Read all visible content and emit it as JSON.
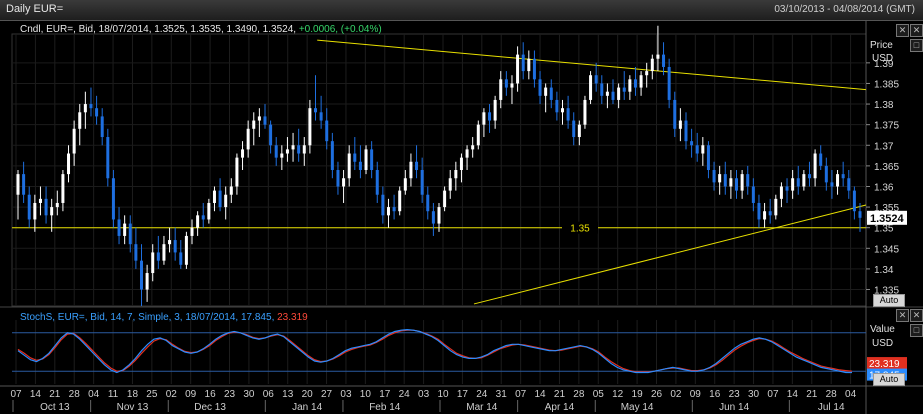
{
  "window": {
    "title": "Daily EUR=",
    "date_range": "03/10/2013 - 04/08/2014 (GMT)"
  },
  "price_panel": {
    "legend": {
      "prefix": "Cndl, EUR=, Bid, 18/07/2014, 1.3525, 1.3535, 1.3490, 1.3524,",
      "change": "+0.0006, (+0.04%)"
    },
    "axis_title_1": "Price",
    "axis_title_2": "USD",
    "last_price": "1.3524",
    "auto_label": "Auto",
    "ticks": [
      "1.39",
      "1.385",
      "1.38",
      "1.375",
      "1.37",
      "1.365",
      "1.36",
      "1.355",
      "1.35",
      "1.345",
      "1.34",
      "1.335"
    ],
    "hline_label": "1.35"
  },
  "stoch_panel": {
    "legend": {
      "prefix": "StochS, EUR=, Bid, 14, 7, Simple, 3, 18/07/2014,",
      "k": "17.845",
      "d": "23.319"
    },
    "axis_title_1": "Value",
    "axis_title_2": "USD",
    "d_badge": "23.319",
    "k_badge": "17.845",
    "auto_label": "Auto"
  },
  "x_axis": {
    "days": [
      "07",
      "14",
      "21",
      "28",
      "04",
      "11",
      "18",
      "25",
      "02",
      "09",
      "16",
      "23",
      "30",
      "06",
      "13",
      "20",
      "27",
      "03",
      "10",
      "17",
      "24",
      "03",
      "10",
      "17",
      "24",
      "31",
      "07",
      "14",
      "21",
      "28",
      "05",
      "12",
      "19",
      "26",
      "02",
      "09",
      "16",
      "23",
      "30",
      "07",
      "14",
      "21",
      "28",
      "04"
    ],
    "months": [
      "Oct 13",
      "Nov 13",
      "Dec 13",
      "Jan 14",
      "Feb 14",
      "Mar 14",
      "Apr 14",
      "May 14",
      "Jun 14",
      "Jul 14"
    ]
  },
  "colors": {
    "up": "#ffffff",
    "down": "#1e6fe0",
    "trendline": "#e8e000",
    "stoch_d": "#e03020",
    "stoch_k": "#2a8cff"
  },
  "chart_data": {
    "type": "candlestick",
    "title": "Daily EUR=",
    "ylim": [
      1.331,
      1.397
    ],
    "horizontal_line": 1.35,
    "trendlines": [
      {
        "name": "resistance",
        "from": [
          "2014-01-20",
          1.3955
        ],
        "to": [
          "2014-08-04",
          1.3835
        ]
      },
      {
        "name": "support",
        "from": [
          "2014-03-17",
          1.3315
        ],
        "to": [
          "2014-08-04",
          1.3555
        ]
      }
    ],
    "candles": [
      [
        1.358,
        1.364,
        1.352,
        1.363
      ],
      [
        1.363,
        1.366,
        1.356,
        1.358
      ],
      [
        1.358,
        1.36,
        1.35,
        1.352
      ],
      [
        1.352,
        1.358,
        1.349,
        1.356
      ],
      [
        1.356,
        1.36,
        1.353,
        1.357
      ],
      [
        1.357,
        1.36,
        1.351,
        1.353
      ],
      [
        1.353,
        1.357,
        1.349,
        1.355
      ],
      [
        1.355,
        1.359,
        1.353,
        1.356
      ],
      [
        1.356,
        1.364,
        1.354,
        1.363
      ],
      [
        1.363,
        1.37,
        1.361,
        1.368
      ],
      [
        1.368,
        1.376,
        1.365,
        1.374
      ],
      [
        1.374,
        1.38,
        1.37,
        1.378
      ],
      [
        1.378,
        1.383,
        1.374,
        1.38
      ],
      [
        1.38,
        1.384,
        1.377,
        1.379
      ],
      [
        1.379,
        1.382,
        1.375,
        1.377
      ],
      [
        1.377,
        1.379,
        1.37,
        1.372
      ],
      [
        1.372,
        1.374,
        1.36,
        1.362
      ],
      [
        1.362,
        1.364,
        1.35,
        1.352
      ],
      [
        1.352,
        1.355,
        1.346,
        1.348
      ],
      [
        1.348,
        1.353,
        1.346,
        1.351
      ],
      [
        1.351,
        1.353,
        1.344,
        1.346
      ],
      [
        1.346,
        1.35,
        1.34,
        1.342
      ],
      [
        1.342,
        1.346,
        1.331,
        1.335
      ],
      [
        1.335,
        1.341,
        1.332,
        1.339
      ],
      [
        1.339,
        1.346,
        1.337,
        1.344
      ],
      [
        1.344,
        1.348,
        1.34,
        1.342
      ],
      [
        1.342,
        1.348,
        1.341,
        1.346
      ],
      [
        1.346,
        1.35,
        1.344,
        1.347
      ],
      [
        1.347,
        1.35,
        1.342,
        1.344
      ],
      [
        1.344,
        1.347,
        1.34,
        1.341
      ],
      [
        1.341,
        1.349,
        1.34,
        1.348
      ],
      [
        1.348,
        1.352,
        1.346,
        1.35
      ],
      [
        1.35,
        1.354,
        1.348,
        1.353
      ],
      [
        1.353,
        1.356,
        1.35,
        1.352
      ],
      [
        1.352,
        1.357,
        1.351,
        1.356
      ],
      [
        1.356,
        1.36,
        1.354,
        1.359
      ],
      [
        1.359,
        1.362,
        1.354,
        1.355
      ],
      [
        1.355,
        1.36,
        1.352,
        1.358
      ],
      [
        1.358,
        1.362,
        1.356,
        1.36
      ],
      [
        1.36,
        1.368,
        1.358,
        1.367
      ],
      [
        1.367,
        1.371,
        1.364,
        1.369
      ],
      [
        1.369,
        1.376,
        1.367,
        1.374
      ],
      [
        1.374,
        1.378,
        1.37,
        1.376
      ],
      [
        1.376,
        1.379,
        1.372,
        1.377
      ],
      [
        1.377,
        1.38,
        1.374,
        1.375
      ],
      [
        1.375,
        1.376,
        1.368,
        1.37
      ],
      [
        1.37,
        1.372,
        1.365,
        1.367
      ],
      [
        1.367,
        1.37,
        1.364,
        1.368
      ],
      [
        1.368,
        1.372,
        1.366,
        1.369
      ],
      [
        1.369,
        1.373,
        1.366,
        1.37
      ],
      [
        1.37,
        1.374,
        1.366,
        1.368
      ],
      [
        1.368,
        1.372,
        1.365,
        1.37
      ],
      [
        1.37,
        1.381,
        1.368,
        1.379
      ],
      [
        1.379,
        1.387,
        1.376,
        1.378
      ],
      [
        1.378,
        1.382,
        1.374,
        1.376
      ],
      [
        1.376,
        1.379,
        1.369,
        1.371
      ],
      [
        1.371,
        1.373,
        1.362,
        1.364
      ],
      [
        1.364,
        1.366,
        1.358,
        1.36
      ],
      [
        1.36,
        1.364,
        1.356,
        1.362
      ],
      [
        1.362,
        1.37,
        1.36,
        1.368
      ],
      [
        1.368,
        1.372,
        1.364,
        1.366
      ],
      [
        1.366,
        1.37,
        1.362,
        1.364
      ],
      [
        1.364,
        1.37,
        1.363,
        1.369
      ],
      [
        1.369,
        1.371,
        1.362,
        1.364
      ],
      [
        1.364,
        1.366,
        1.356,
        1.358
      ],
      [
        1.358,
        1.36,
        1.351,
        1.353
      ],
      [
        1.353,
        1.357,
        1.35,
        1.355
      ],
      [
        1.355,
        1.358,
        1.352,
        1.354
      ],
      [
        1.354,
        1.36,
        1.353,
        1.359
      ],
      [
        1.359,
        1.364,
        1.358,
        1.362
      ],
      [
        1.362,
        1.368,
        1.36,
        1.366
      ],
      [
        1.366,
        1.37,
        1.362,
        1.364
      ],
      [
        1.364,
        1.367,
        1.356,
        1.358
      ],
      [
        1.358,
        1.36,
        1.352,
        1.354
      ],
      [
        1.354,
        1.356,
        1.348,
        1.351
      ],
      [
        1.351,
        1.356,
        1.349,
        1.355
      ],
      [
        1.355,
        1.36,
        1.354,
        1.359
      ],
      [
        1.359,
        1.364,
        1.357,
        1.362
      ],
      [
        1.362,
        1.366,
        1.359,
        1.364
      ],
      [
        1.364,
        1.368,
        1.361,
        1.367
      ],
      [
        1.367,
        1.37,
        1.364,
        1.369
      ],
      [
        1.369,
        1.372,
        1.367,
        1.37
      ],
      [
        1.37,
        1.376,
        1.369,
        1.375
      ],
      [
        1.375,
        1.379,
        1.372,
        1.378
      ],
      [
        1.378,
        1.38,
        1.373,
        1.376
      ],
      [
        1.376,
        1.382,
        1.374,
        1.381
      ],
      [
        1.381,
        1.388,
        1.379,
        1.386
      ],
      [
        1.386,
        1.388,
        1.382,
        1.384
      ],
      [
        1.384,
        1.387,
        1.38,
        1.385
      ],
      [
        1.385,
        1.394,
        1.383,
        1.392
      ],
      [
        1.392,
        1.395,
        1.386,
        1.388
      ],
      [
        1.388,
        1.393,
        1.386,
        1.391
      ],
      [
        1.391,
        1.393,
        1.384,
        1.386
      ],
      [
        1.386,
        1.388,
        1.38,
        1.382
      ],
      [
        1.382,
        1.385,
        1.378,
        1.384
      ],
      [
        1.384,
        1.386,
        1.379,
        1.381
      ],
      [
        1.381,
        1.383,
        1.376,
        1.378
      ],
      [
        1.378,
        1.381,
        1.375,
        1.379
      ],
      [
        1.379,
        1.382,
        1.374,
        1.376
      ],
      [
        1.376,
        1.378,
        1.37,
        1.372
      ],
      [
        1.372,
        1.376,
        1.37,
        1.375
      ],
      [
        1.375,
        1.382,
        1.374,
        1.381
      ],
      [
        1.381,
        1.388,
        1.38,
        1.387
      ],
      [
        1.387,
        1.39,
        1.383,
        1.385
      ],
      [
        1.385,
        1.387,
        1.38,
        1.382
      ],
      [
        1.382,
        1.385,
        1.379,
        1.383
      ],
      [
        1.383,
        1.386,
        1.38,
        1.381
      ],
      [
        1.381,
        1.385,
        1.379,
        1.384
      ],
      [
        1.384,
        1.388,
        1.381,
        1.383
      ],
      [
        1.383,
        1.387,
        1.381,
        1.386
      ],
      [
        1.386,
        1.389,
        1.382,
        1.384
      ],
      [
        1.384,
        1.388,
        1.382,
        1.387
      ],
      [
        1.387,
        1.39,
        1.384,
        1.388
      ],
      [
        1.388,
        1.392,
        1.386,
        1.391
      ],
      [
        1.391,
        1.399,
        1.388,
        1.392
      ],
      [
        1.392,
        1.395,
        1.387,
        1.389
      ],
      [
        1.389,
        1.391,
        1.379,
        1.381
      ],
      [
        1.381,
        1.383,
        1.372,
        1.374
      ],
      [
        1.374,
        1.379,
        1.371,
        1.376
      ],
      [
        1.376,
        1.378,
        1.369,
        1.371
      ],
      [
        1.371,
        1.374,
        1.367,
        1.37
      ],
      [
        1.37,
        1.373,
        1.366,
        1.368
      ],
      [
        1.368,
        1.372,
        1.365,
        1.37
      ],
      [
        1.37,
        1.371,
        1.362,
        1.364
      ],
      [
        1.364,
        1.366,
        1.359,
        1.361
      ],
      [
        1.361,
        1.365,
        1.358,
        1.363
      ],
      [
        1.363,
        1.366,
        1.358,
        1.36
      ],
      [
        1.36,
        1.364,
        1.357,
        1.362
      ],
      [
        1.362,
        1.364,
        1.357,
        1.359
      ],
      [
        1.359,
        1.364,
        1.357,
        1.363
      ],
      [
        1.363,
        1.365,
        1.358,
        1.36
      ],
      [
        1.36,
        1.362,
        1.354,
        1.356
      ],
      [
        1.356,
        1.358,
        1.35,
        1.352
      ],
      [
        1.352,
        1.356,
        1.35,
        1.354
      ],
      [
        1.354,
        1.357,
        1.351,
        1.353
      ],
      [
        1.353,
        1.358,
        1.352,
        1.357
      ],
      [
        1.357,
        1.361,
        1.355,
        1.36
      ],
      [
        1.36,
        1.362,
        1.356,
        1.359
      ],
      [
        1.359,
        1.364,
        1.357,
        1.362
      ],
      [
        1.362,
        1.365,
        1.358,
        1.36
      ],
      [
        1.36,
        1.364,
        1.359,
        1.363
      ],
      [
        1.363,
        1.366,
        1.36,
        1.362
      ],
      [
        1.362,
        1.369,
        1.36,
        1.368
      ],
      [
        1.368,
        1.37,
        1.364,
        1.365
      ],
      [
        1.365,
        1.367,
        1.359,
        1.361
      ],
      [
        1.361,
        1.364,
        1.357,
        1.36
      ],
      [
        1.36,
        1.364,
        1.358,
        1.363
      ],
      [
        1.363,
        1.366,
        1.36,
        1.362
      ],
      [
        1.362,
        1.364,
        1.357,
        1.359
      ],
      [
        1.359,
        1.36,
        1.352,
        1.354
      ],
      [
        1.354,
        1.356,
        1.349,
        1.3524
      ]
    ],
    "stochastic": {
      "params": "14, 7, Simple, 3",
      "k_last": 17.845,
      "d_last": 23.319,
      "k": [
        52,
        45,
        38,
        35,
        40,
        48,
        60,
        72,
        80,
        78,
        70,
        60,
        50,
        40,
        30,
        22,
        18,
        22,
        30,
        40,
        52,
        62,
        70,
        72,
        68,
        60,
        55,
        50,
        48,
        50,
        55,
        62,
        70,
        76,
        80,
        82,
        80,
        76,
        72,
        70,
        72,
        76,
        78,
        74,
        66,
        58,
        50,
        42,
        36,
        34,
        36,
        40,
        46,
        52,
        56,
        58,
        60,
        62,
        66,
        72,
        78,
        82,
        84,
        85,
        84,
        82,
        78,
        74,
        68,
        60,
        52,
        46,
        42,
        40,
        40,
        42,
        46,
        52,
        56,
        60,
        62,
        62,
        60,
        58,
        56,
        54,
        52,
        52,
        54,
        56,
        58,
        60,
        58,
        54,
        48,
        40,
        32,
        26,
        22,
        20,
        18,
        18,
        18,
        20,
        22,
        24,
        26,
        24,
        22,
        20,
        20,
        22,
        26,
        32,
        40,
        48,
        56,
        62,
        66,
        70,
        72,
        70,
        66,
        60,
        54,
        48,
        42,
        38,
        34,
        30,
        26,
        24,
        22,
        20,
        18,
        18
      ],
      "d": [
        54,
        48,
        41,
        37,
        39,
        46,
        57,
        69,
        78,
        79,
        72,
        63,
        53,
        43,
        33,
        25,
        20,
        21,
        28,
        37,
        48,
        58,
        67,
        71,
        69,
        62,
        56,
        51,
        49,
        50,
        54,
        60,
        68,
        74,
        79,
        81,
        80,
        77,
        73,
        71,
        72,
        75,
        77,
        75,
        68,
        60,
        52,
        44,
        38,
        35,
        36,
        39,
        44,
        50,
        54,
        57,
        59,
        61,
        65,
        70,
        76,
        80,
        83,
        84,
        84,
        82,
        79,
        75,
        70,
        62,
        55,
        48,
        44,
        41,
        40,
        41,
        45,
        50,
        55,
        58,
        61,
        62,
        61,
        59,
        57,
        55,
        53,
        52,
        53,
        55,
        57,
        59,
        58,
        55,
        50,
        42,
        35,
        29,
        24,
        21,
        19,
        19,
        19,
        20,
        22,
        24,
        25,
        25,
        23,
        21,
        21,
        22,
        25,
        30,
        37,
        45,
        53,
        59,
        64,
        68,
        71,
        70,
        67,
        62,
        56,
        50,
        45,
        40,
        36,
        32,
        28,
        26,
        24,
        22,
        21,
        20
      ]
    }
  }
}
